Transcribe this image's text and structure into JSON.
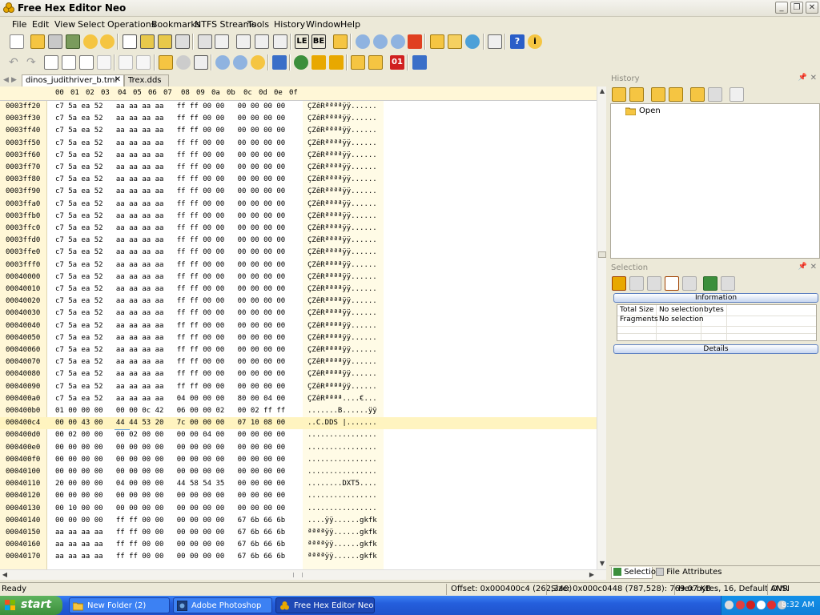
{
  "window": {
    "title": "Free Hex Editor Neo",
    "controls": [
      "minimize",
      "maximize",
      "close"
    ]
  },
  "menu": [
    "File",
    "Edit",
    "View",
    "Select",
    "Operations",
    "Bookmarks",
    "NTFS Streams",
    "Tools",
    "History",
    "Window",
    "Help"
  ],
  "toolbar1": {
    "icons": [
      "new-file-icon",
      "open-file-icon",
      "open-drive-icon",
      "open-memory-icon",
      "open-process-icon",
      "save-icon",
      "save-all-icon",
      "save-as-icon",
      "print-icon",
      "properties-icon",
      "print-setup-icon",
      "export-icon",
      "import-icon",
      "little-endian-icon",
      "big-endian-icon",
      "grid-icon",
      "find-icon",
      "find-next-icon",
      "find-prev-icon",
      "plugin-icon",
      "bookmark-icon",
      "mail-icon",
      "web-icon",
      "calculator-icon",
      "help-icon",
      "about-icon"
    ],
    "labels": {
      "little_endian": "LE",
      "big_endian": "BE"
    }
  },
  "toolbar2": {
    "icons": [
      "undo-icon",
      "redo-icon",
      "edit-icon",
      "copy-icon",
      "paste-icon",
      "delete-icon",
      "fill-icon",
      "cut-icon",
      "insert-icon",
      "modify-icon",
      "resize-icon",
      "zoom-in-icon",
      "zoom-out-icon",
      "zoom-reset-icon",
      "tools-icon",
      "shift-left-icon",
      "shift-right-icon",
      "collapse-icon",
      "lock-icon",
      "unlock-icon",
      "binary-icon",
      "pencil-icon"
    ],
    "labels": {
      "binary": "01"
    }
  },
  "doc_tabs": [
    {
      "label": "dinos_judithriver_b.tml",
      "active": true
    },
    {
      "label": "Trex.dds",
      "active": false
    }
  ],
  "hex_header": [
    "00",
    "01",
    "02",
    "03",
    "04",
    "05",
    "06",
    "07",
    "08",
    "09",
    "0a",
    "0b",
    "0c",
    "0d",
    "0e",
    "0f"
  ],
  "hex_rows": [
    {
      "offset": "0003ff20",
      "bytes": "c7 5a ea 52   aa aa aa aa   ff ff 00 00   00 00 00 00",
      "text": "ÇZêRªªªªÿÿ......"
    },
    {
      "offset": "0003ff30",
      "bytes": "c7 5a ea 52   aa aa aa aa   ff ff 00 00   00 00 00 00",
      "text": "ÇZêRªªªªÿÿ......"
    },
    {
      "offset": "0003ff40",
      "bytes": "c7 5a ea 52   aa aa aa aa   ff ff 00 00   00 00 00 00",
      "text": "ÇZêRªªªªÿÿ......"
    },
    {
      "offset": "0003ff50",
      "bytes": "c7 5a ea 52   aa aa aa aa   ff ff 00 00   00 00 00 00",
      "text": "ÇZêRªªªªÿÿ......"
    },
    {
      "offset": "0003ff60",
      "bytes": "c7 5a ea 52   aa aa aa aa   ff ff 00 00   00 00 00 00",
      "text": "ÇZêRªªªªÿÿ......"
    },
    {
      "offset": "0003ff70",
      "bytes": "c7 5a ea 52   aa aa aa aa   ff ff 00 00   00 00 00 00",
      "text": "ÇZêRªªªªÿÿ......"
    },
    {
      "offset": "0003ff80",
      "bytes": "c7 5a ea 52   aa aa aa aa   ff ff 00 00   00 00 00 00",
      "text": "ÇZêRªªªªÿÿ......"
    },
    {
      "offset": "0003ff90",
      "bytes": "c7 5a ea 52   aa aa aa aa   ff ff 00 00   00 00 00 00",
      "text": "ÇZêRªªªªÿÿ......"
    },
    {
      "offset": "0003ffa0",
      "bytes": "c7 5a ea 52   aa aa aa aa   ff ff 00 00   00 00 00 00",
      "text": "ÇZêRªªªªÿÿ......"
    },
    {
      "offset": "0003ffb0",
      "bytes": "c7 5a ea 52   aa aa aa aa   ff ff 00 00   00 00 00 00",
      "text": "ÇZêRªªªªÿÿ......"
    },
    {
      "offset": "0003ffc0",
      "bytes": "c7 5a ea 52   aa aa aa aa   ff ff 00 00   00 00 00 00",
      "text": "ÇZêRªªªªÿÿ......"
    },
    {
      "offset": "0003ffd0",
      "bytes": "c7 5a ea 52   aa aa aa aa   ff ff 00 00   00 00 00 00",
      "text": "ÇZêRªªªªÿÿ......"
    },
    {
      "offset": "0003ffe0",
      "bytes": "c7 5a ea 52   aa aa aa aa   ff ff 00 00   00 00 00 00",
      "text": "ÇZêRªªªªÿÿ......"
    },
    {
      "offset": "0003fff0",
      "bytes": "c7 5a ea 52   aa aa aa aa   ff ff 00 00   00 00 00 00",
      "text": "ÇZêRªªªªÿÿ......"
    },
    {
      "offset": "00040000",
      "bytes": "c7 5a ea 52   aa aa aa aa   ff ff 00 00   00 00 00 00",
      "text": "ÇZêRªªªªÿÿ......"
    },
    {
      "offset": "00040010",
      "bytes": "c7 5a ea 52   aa aa aa aa   ff ff 00 00   00 00 00 00",
      "text": "ÇZêRªªªªÿÿ......"
    },
    {
      "offset": "00040020",
      "bytes": "c7 5a ea 52   aa aa aa aa   ff ff 00 00   00 00 00 00",
      "text": "ÇZêRªªªªÿÿ......"
    },
    {
      "offset": "00040030",
      "bytes": "c7 5a ea 52   aa aa aa aa   ff ff 00 00   00 00 00 00",
      "text": "ÇZêRªªªªÿÿ......"
    },
    {
      "offset": "00040040",
      "bytes": "c7 5a ea 52   aa aa aa aa   ff ff 00 00   00 00 00 00",
      "text": "ÇZêRªªªªÿÿ......"
    },
    {
      "offset": "00040050",
      "bytes": "c7 5a ea 52   aa aa aa aa   ff ff 00 00   00 00 00 00",
      "text": "ÇZêRªªªªÿÿ......"
    },
    {
      "offset": "00040060",
      "bytes": "c7 5a ea 52   aa aa aa aa   ff ff 00 00   00 00 00 00",
      "text": "ÇZêRªªªªÿÿ......"
    },
    {
      "offset": "00040070",
      "bytes": "c7 5a ea 52   aa aa aa aa   ff ff 00 00   00 00 00 00",
      "text": "ÇZêRªªªªÿÿ......"
    },
    {
      "offset": "00040080",
      "bytes": "c7 5a ea 52   aa aa aa aa   ff ff 00 00   00 00 00 00",
      "text": "ÇZêRªªªªÿÿ......"
    },
    {
      "offset": "00040090",
      "bytes": "c7 5a ea 52   aa aa aa aa   ff ff 00 00   00 00 00 00",
      "text": "ÇZêRªªªªÿÿ......"
    },
    {
      "offset": "000400a0",
      "bytes": "c7 5a ea 52   aa aa aa aa   04 00 00 00   80 00 04 00",
      "text": "ÇZêRªªªª....€..."
    },
    {
      "offset": "000400b0",
      "bytes": "01 00 00 00   00 00 0c 42   06 00 00 02   00 02 ff ff",
      "text": ".......B......ÿÿ"
    },
    {
      "offset": "000400c4",
      "bytes": "00 00 43 00   44 44 53 20   7c 00 00 00   07 10 08 00",
      "text": "..C.DDS |......."
    },
    {
      "offset": "000400d0",
      "bytes": "00 02 00 00   00 02 00 00   00 00 04 00   00 00 00 00",
      "text": "................"
    },
    {
      "offset": "000400e0",
      "bytes": "00 00 00 00   00 00 00 00   00 00 00 00   00 00 00 00",
      "text": "................"
    },
    {
      "offset": "000400f0",
      "bytes": "00 00 00 00   00 00 00 00   00 00 00 00   00 00 00 00",
      "text": "................"
    },
    {
      "offset": "00040100",
      "bytes": "00 00 00 00   00 00 00 00   00 00 00 00   00 00 00 00",
      "text": "................"
    },
    {
      "offset": "00040110",
      "bytes": "20 00 00 00   04 00 00 00   44 58 54 35   00 00 00 00",
      "text": "........DXT5...."
    },
    {
      "offset": "00040120",
      "bytes": "00 00 00 00   00 00 00 00   00 00 00 00   00 00 00 00",
      "text": "................"
    },
    {
      "offset": "00040130",
      "bytes": "00 10 00 00   00 00 00 00   00 00 00 00   00 00 00 00",
      "text": "................"
    },
    {
      "offset": "00040140",
      "bytes": "00 00 00 00   ff ff 00 00   00 00 00 00   67 6b 66 6b",
      "text": "....ÿÿ......gkfk"
    },
    {
      "offset": "00040150",
      "bytes": "aa aa aa aa   ff ff 00 00   00 00 00 00   67 6b 66 6b",
      "text": "ªªªªÿÿ......gkfk"
    },
    {
      "offset": "00040160",
      "bytes": "aa aa aa aa   ff ff 00 00   00 00 00 00   67 6b 66 6b",
      "text": "ªªªªÿÿ......gkfk"
    },
    {
      "offset": "00040170",
      "bytes": "aa aa aa aa   ff ff 00 00   00 00 00 00   67 6b 66 6b",
      "text": "ªªªªÿÿ......gkfk"
    }
  ],
  "panels": {
    "history": {
      "title": "History",
      "items": [
        {
          "label": "Open",
          "icon": "folder-icon"
        }
      ]
    },
    "selection": {
      "title": "Selection",
      "information": {
        "header": "Information",
        "rows": [
          {
            "label": "Total Size",
            "value": "No selection",
            "unit": "bytes"
          },
          {
            "label": "Fragments",
            "value": "No selection",
            "unit": ""
          }
        ]
      },
      "details_header": "Details"
    },
    "bottom_tabs": [
      {
        "label": "Selection",
        "active": true
      },
      {
        "label": "File Attributes",
        "active": false
      }
    ]
  },
  "status": {
    "ready": "Ready",
    "offset": "Offset: 0x000400c4 (262,340)",
    "size": "Size: 0x000c0448 (787,528): 769.07 KB",
    "mode": "Hex bytes, 16, Default ANSI",
    "insert": "OVR"
  },
  "taskbar": {
    "start": "start",
    "tasks": [
      {
        "label": "New Folder (2)",
        "icon": "folder-icon",
        "active": false
      },
      {
        "label": "Adobe Photoshop",
        "icon": "photoshop-icon",
        "active": false
      },
      {
        "label": "Free Hex Editor Neo",
        "icon": "hex-editor-icon",
        "active": true
      }
    ],
    "clock": "8:32 AM"
  },
  "colors": {
    "hex_bg_header": "#FFF7D7",
    "selection_highlight": "#D8E9F8",
    "taskbar_blue": "#245EDC",
    "start_green": "#3C8F3C"
  }
}
